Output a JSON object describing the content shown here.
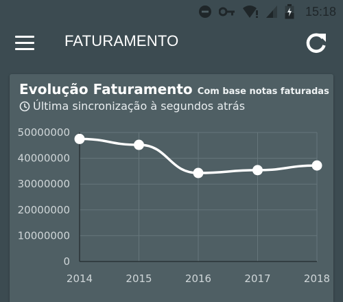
{
  "status_bar": {
    "time": "15:18",
    "icons": [
      "do-not-disturb-icon",
      "vpn-key-icon",
      "wifi-icon",
      "signal-icon",
      "battery-charging-icon"
    ]
  },
  "app_bar": {
    "title": "FATURAMENTO",
    "menu_icon": "menu-icon",
    "refresh_icon": "refresh-icon"
  },
  "card": {
    "title": "Evolução Faturamento",
    "subtitle": "Com base notas faturadas",
    "sync_text": "Última sincronização à segundos atrás",
    "sync_icon": "clock-icon"
  },
  "colors": {
    "background": "#3c4b51",
    "card": "#4f5f64",
    "line": "#ffffff"
  },
  "chart_data": {
    "type": "line",
    "x": [
      2014,
      2015,
      2016,
      2017,
      2018
    ],
    "x_tick_labels": [
      "2014",
      "2015",
      "2016",
      "2017",
      "2018"
    ],
    "y_tick_labels": [
      "0",
      "10000000",
      "20000000",
      "30000000",
      "40000000",
      "50000000"
    ],
    "y_ticks": [
      0,
      10000000,
      20000000,
      30000000,
      40000000,
      50000000
    ],
    "series": [
      {
        "values": [
          47500000,
          45200000,
          34300000,
          35400000,
          37200000
        ]
      }
    ],
    "ylim": [
      0,
      50000000
    ],
    "xlim": [
      2014,
      2018
    ],
    "grid": true,
    "smooth": true
  }
}
